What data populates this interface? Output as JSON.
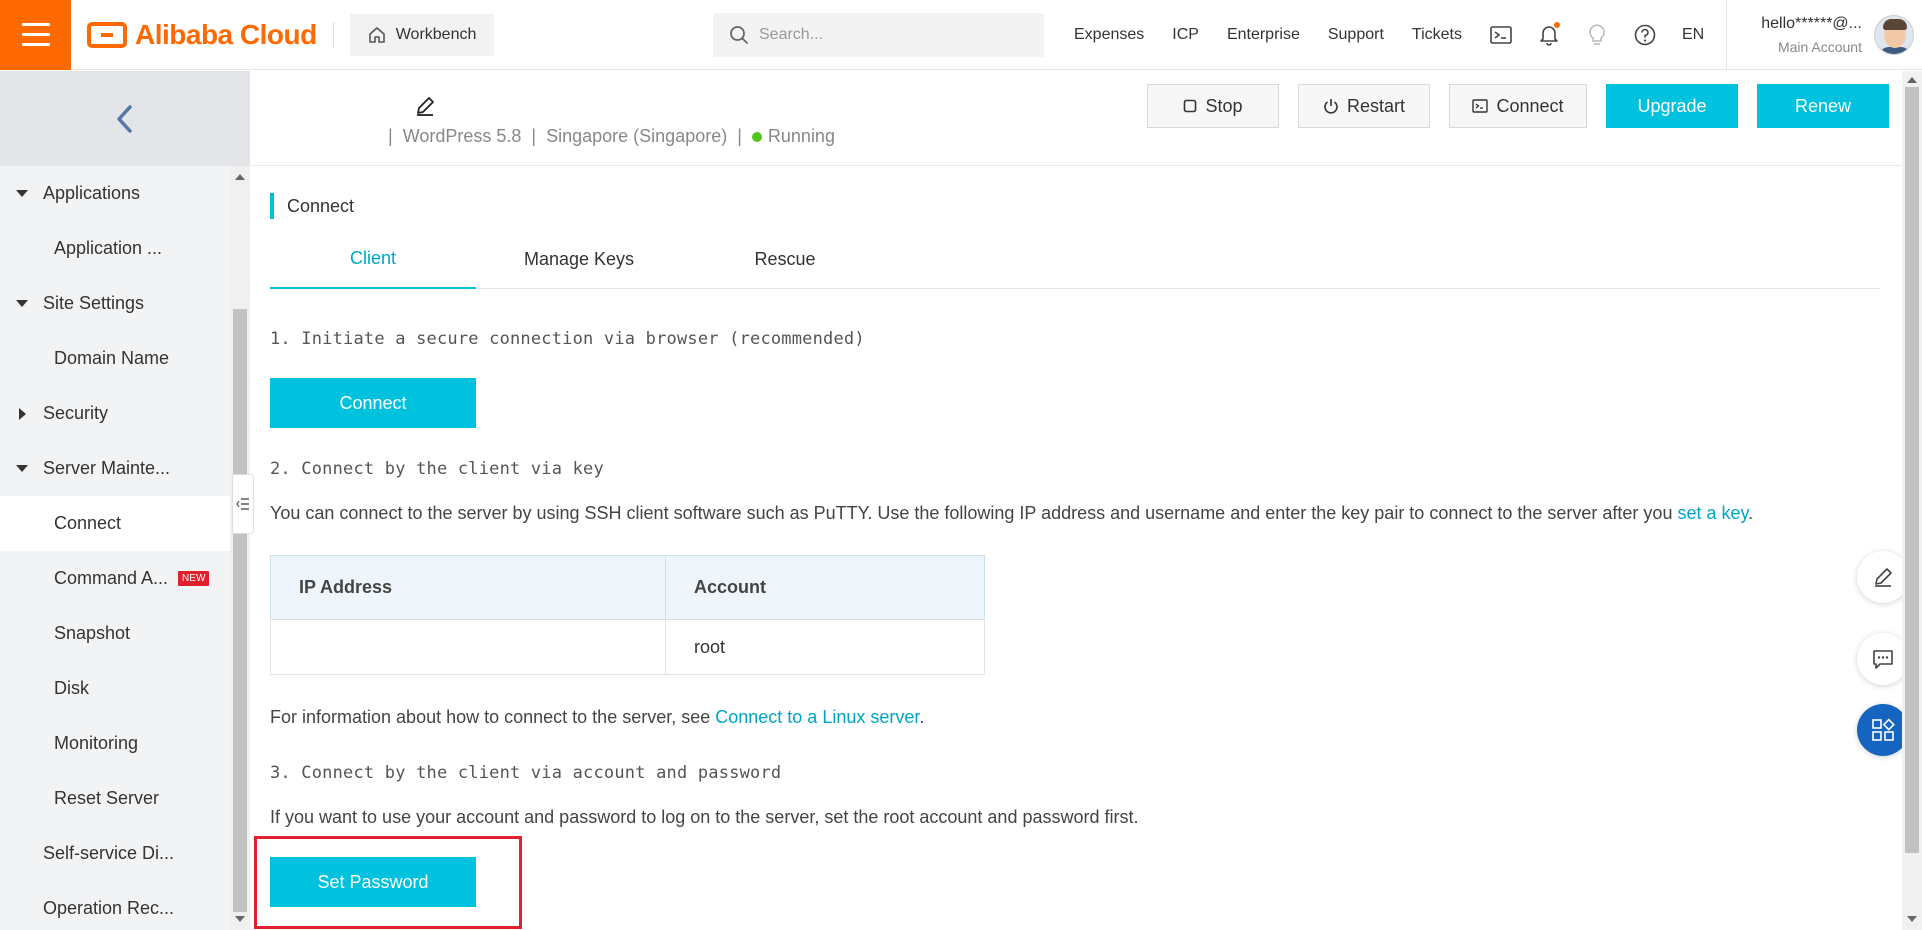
{
  "topbar": {
    "brand": "Alibaba Cloud",
    "workbench": "Workbench",
    "search_placeholder": "Search...",
    "nav": [
      "Expenses",
      "ICP",
      "Enterprise",
      "Support",
      "Tickets"
    ],
    "icons": [
      "terminal-icon",
      "bell-icon",
      "lightbulb-icon",
      "help-icon"
    ],
    "lang": "EN",
    "account_name": "hello******@...",
    "account_type": "Main Account"
  },
  "sidebar": {
    "items": [
      {
        "label": "Applications",
        "type": "group",
        "state": "expanded"
      },
      {
        "label": "Application ...",
        "type": "child"
      },
      {
        "label": "Site Settings",
        "type": "group",
        "state": "expanded"
      },
      {
        "label": "Domain Name",
        "type": "child"
      },
      {
        "label": "Security",
        "type": "group",
        "state": "collapsed"
      },
      {
        "label": "Server Mainte...",
        "type": "group",
        "state": "expanded"
      },
      {
        "label": "Connect",
        "type": "child",
        "active": true
      },
      {
        "label": "Command A...",
        "type": "child",
        "badge": "NEW"
      },
      {
        "label": "Snapshot",
        "type": "child"
      },
      {
        "label": "Disk",
        "type": "child"
      },
      {
        "label": "Monitoring",
        "type": "child"
      },
      {
        "label": "Reset Server",
        "type": "child"
      },
      {
        "label": "Self-service Di...",
        "type": "group"
      },
      {
        "label": "Operation Rec...",
        "type": "group"
      }
    ]
  },
  "instance": {
    "app": "WordPress 5.8",
    "region": "Singapore (Singapore)",
    "status": "Running",
    "actions": {
      "stop": "Stop",
      "restart": "Restart",
      "connect": "Connect",
      "upgrade": "Upgrade",
      "renew": "Renew"
    }
  },
  "main": {
    "section_title": "Connect",
    "tabs": [
      "Client",
      "Manage Keys",
      "Rescue"
    ],
    "active_tab": "Client",
    "step1": "1. Initiate a secure connection via browser (recommended)",
    "connect_button": "Connect",
    "step2": "2. Connect by the client via key",
    "step2_desc": "You can connect to the server by using SSH client software such as PuTTY. Use the following IP address and username and enter the key pair to connect to the server after you ",
    "step2_link": "set a key",
    "step2_end": ".",
    "table": {
      "headers": [
        "IP Address",
        "Account"
      ],
      "rows": [
        [
          "",
          "root"
        ]
      ]
    },
    "info_text": "For information about how to connect to the server, see ",
    "info_link": "Connect to a Linux server",
    "info_end": ".",
    "step3": "3. Connect by the client via account and password",
    "step3_desc": "If you want to use your account and password to log on to the server, set the root account and password first.",
    "set_password_button": "Set Password"
  },
  "colors": {
    "brand_orange": "#ff6a00",
    "primary_cyan": "#00c1de",
    "link": "#00a5c6",
    "highlight_red": "#e0202d",
    "running_green": "#52c41a"
  }
}
